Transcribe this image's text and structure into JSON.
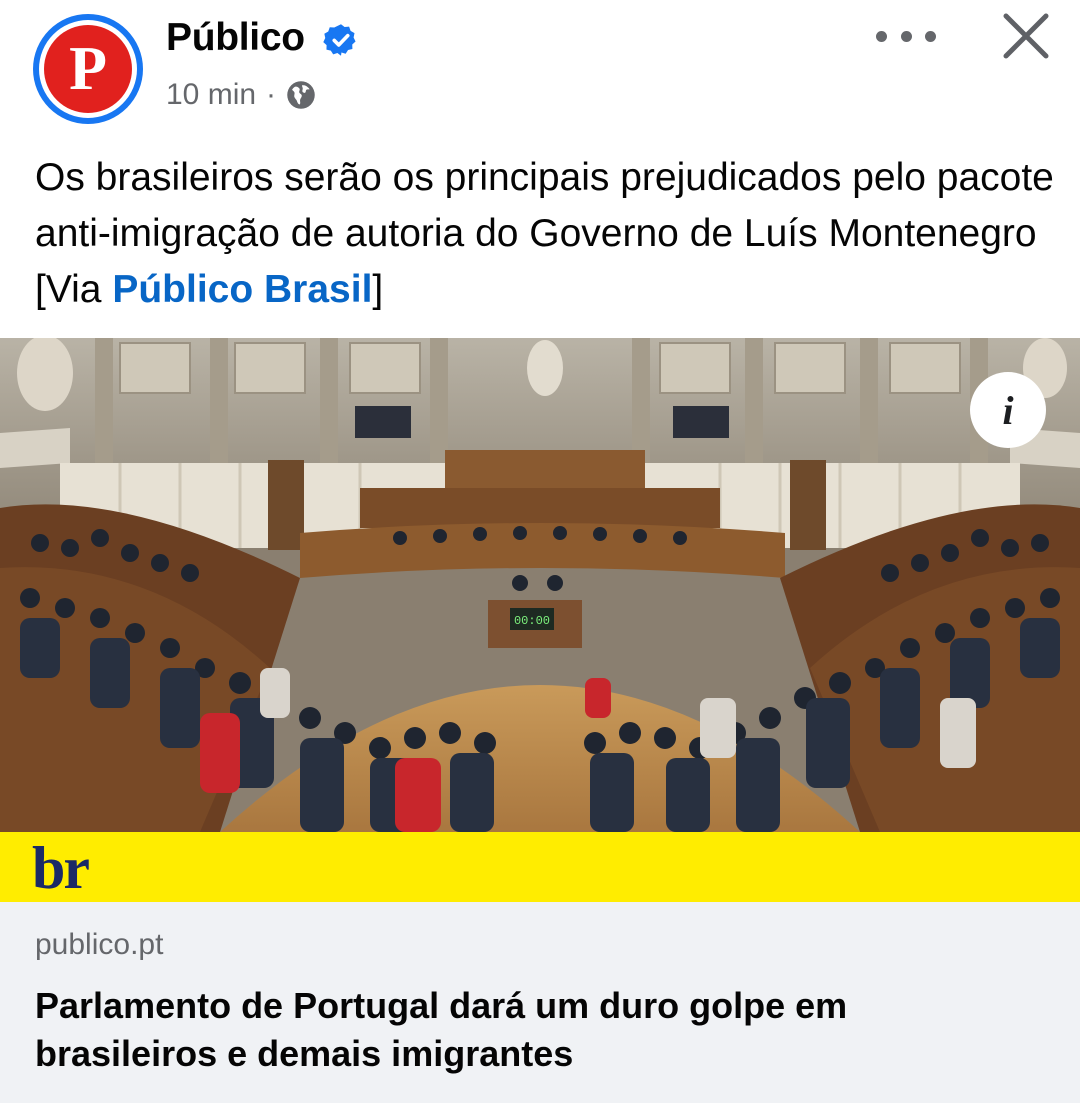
{
  "post": {
    "page_name": "Público",
    "avatar_letter": "P",
    "time": "10 min",
    "separator": "·",
    "privacy_icon": "globe-icon",
    "verified_icon": "verified-badge-icon",
    "caption_prefix": "Os brasileiros serão os principais prejudicados pelo pacote anti-imigração de autoria do Governo de Luís Montenegro [Via ",
    "caption_link": "Público Brasil",
    "caption_suffix": "]"
  },
  "photo": {
    "clock_text": "00:00",
    "info_glyph": "i"
  },
  "link_preview": {
    "brand_text": "br",
    "domain": "publico.pt",
    "headline": "Parlamento de Portugal dará um duro golpe em brasileiros e demais imigrantes"
  },
  "colors": {
    "accent_blue": "#0866c6",
    "brand_red": "#e1211e",
    "verified_blue": "#1877f2",
    "band_yellow": "#ffed00",
    "card_gray": "#f0f2f5"
  }
}
